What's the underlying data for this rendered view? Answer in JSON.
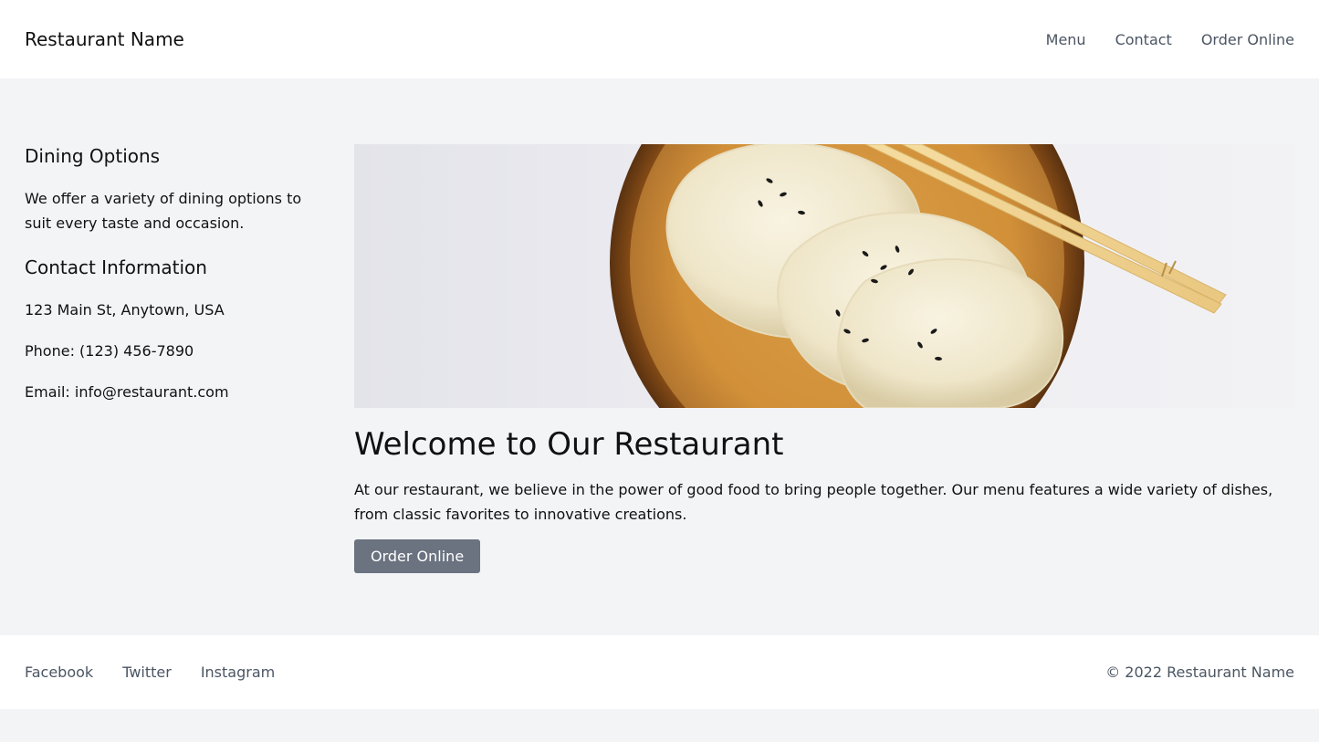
{
  "header": {
    "brand": "Restaurant Name",
    "nav": [
      "Menu",
      "Contact",
      "Order Online"
    ]
  },
  "sidebar": {
    "dining_title": "Dining Options",
    "dining_text": "We offer a variety of dining options to suit every taste and occasion.",
    "contact_title": "Contact Information",
    "address": "123 Main St, Anytown, USA",
    "phone": "Phone: (123) 456-7890",
    "email": "Email: info@restaurant.com"
  },
  "main": {
    "hero_image": "dumplings-on-wooden-plate-with-chopsticks",
    "title": "Welcome to Our Restaurant",
    "intro": "At our restaurant, we believe in the power of good food to bring people together. Our menu features a wide variety of dishes, from classic favorites to innovative creations.",
    "order_button": "Order Online"
  },
  "footer": {
    "social": [
      "Facebook",
      "Twitter",
      "Instagram"
    ],
    "copyright": "© 2022 Restaurant Name"
  },
  "colors": {
    "page_background": "#f3f4f6",
    "button": "#6b7280",
    "link": "#4b5563"
  }
}
